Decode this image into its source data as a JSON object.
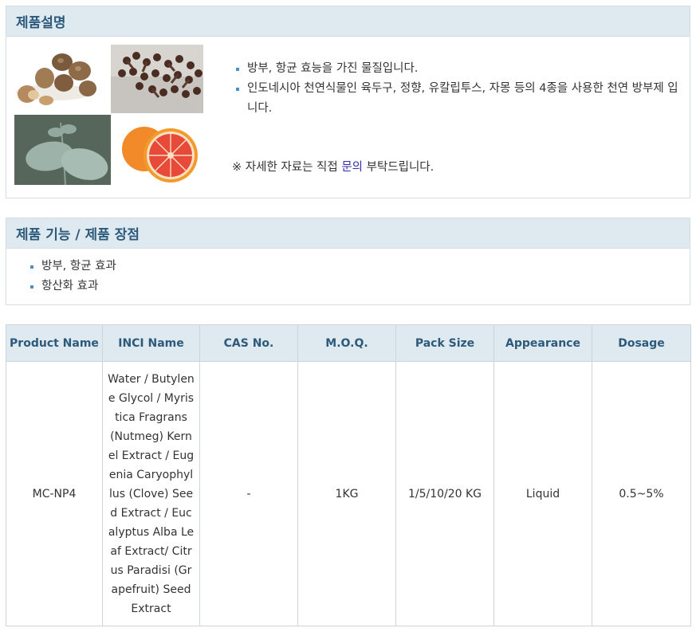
{
  "description": {
    "title": "제품설명",
    "images": [
      {
        "name": "nutmeg-image"
      },
      {
        "name": "clove-image"
      },
      {
        "name": "eucalyptus-image"
      },
      {
        "name": "grapefruit-image"
      }
    ],
    "bullets": [
      "방부, 항균 효능을 가진 물질입니다.",
      "인도네시아 천연식물인 육두구, 정향, 유칼립투스, 자몽 등의 4종을 사용한 천연 방부제 입니다."
    ],
    "note_prefix": "※ 자세한 자료는 직접 ",
    "note_link": "문의",
    "note_suffix": " 부탁드립니다.",
    "accent_color": "#4a90c8",
    "link_color": "#2f2fb0"
  },
  "function": {
    "title": "제품 기능 / 제품 장점",
    "bullets": [
      "방부, 항균 효과",
      "항산화 효과"
    ]
  },
  "table": {
    "headers": [
      "Product Name",
      "INCI Name",
      "CAS No.",
      "M.O.Q.",
      "Pack Size",
      "Appearance",
      "Dosage"
    ],
    "rows": [
      [
        "MC-NP4",
        "Water / Butylene Glycol / Myristica Fragrans (Nutmeg) Kernel Extract / Eugenia Caryophyllus (Clove) Seed Extract / Eucalyptus Alba Leaf Extract/ Citrus Paradisi (Grapefruit) Seed Extract",
        "-",
        "1KG",
        "1/5/10/20 KG",
        "Liquid",
        "0.5~5%"
      ]
    ]
  },
  "colors": {
    "header_bg": "#dfe9f0",
    "header_text": "#2d5a7b",
    "border": "#c9d4dc"
  }
}
